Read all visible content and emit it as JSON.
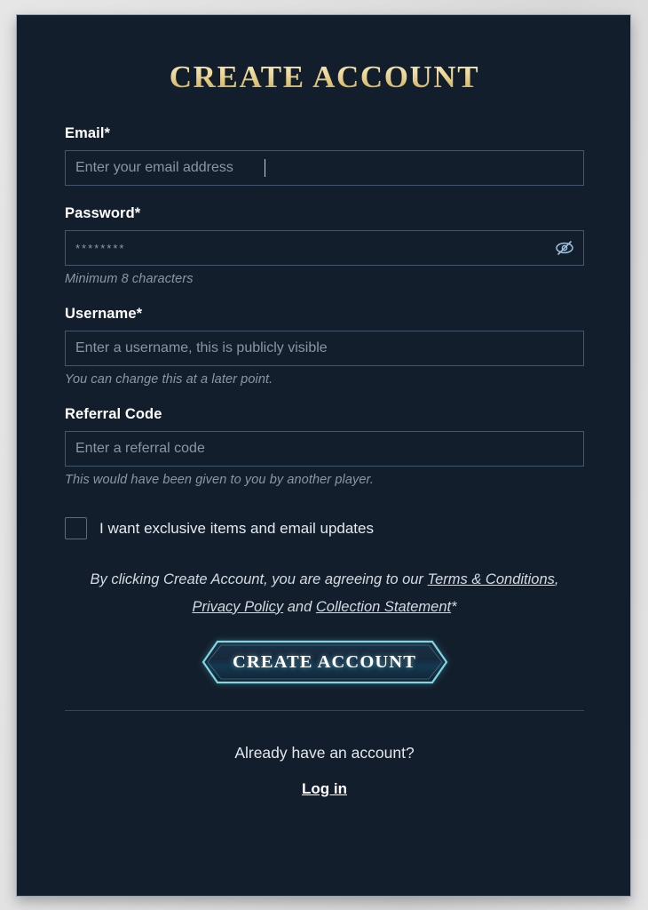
{
  "page": {
    "title": "CREATE ACCOUNT"
  },
  "fields": {
    "email": {
      "label": "Email*",
      "placeholder": "Enter your email address",
      "value": ""
    },
    "password": {
      "label": "Password*",
      "placeholder": "********",
      "value": "",
      "hint": "Minimum 8 characters",
      "toggle_icon": "eye-slash-icon"
    },
    "username": {
      "label": "Username*",
      "placeholder": "Enter a username, this is publicly visible",
      "value": "",
      "hint": "You can change this at a later point."
    },
    "referral": {
      "label": "Referral Code",
      "placeholder": "Enter a referral code",
      "value": "",
      "hint": "This would have been given to you by another player."
    }
  },
  "marketing": {
    "checkbox_label": "I want exclusive items and email updates",
    "checked": false
  },
  "terms": {
    "prefix": "By clicking Create Account, you are agreeing to our ",
    "link_terms": "Terms & Conditions",
    "separator": ", ",
    "link_privacy": "Privacy Policy",
    "conjunction": " and ",
    "link_collection": "Collection Statement",
    "suffix": "*"
  },
  "cta": {
    "label": "CREATE ACCOUNT"
  },
  "footer": {
    "question": "Already have an account?",
    "login_link": "Log in"
  },
  "colors": {
    "panel_background": "#121e2c",
    "page_background": "#e3e3e3",
    "title_gold": "#efdba0",
    "input_border": "#41586f",
    "hint_text": "#8d97a2",
    "cta_outline": "#7fd6e2",
    "divider": "#32455a"
  }
}
